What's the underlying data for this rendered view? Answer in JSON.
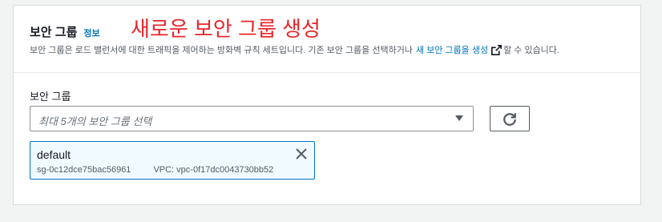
{
  "annotation": "새로운 보안 그룹 생성",
  "header": {
    "title": "보안 그룹",
    "info_link": "정보",
    "description_prefix": "보안 그룹은 로드 밸런서에 대한 트래픽을 제어하는 방화벽 규칙 세트입니다. 기존 보안 그룹을 선택하거나",
    "description_link": "새 보안 그룹을 생성",
    "description_suffix": "할 수 있습니다."
  },
  "field": {
    "label": "보안 그룹",
    "placeholder": "최대 5개의 보안 그룹 선택"
  },
  "selected": [
    {
      "name": "default",
      "id": "sg-0c12dce75bac56961",
      "vpc": "VPC: vpc-0f17dc0043730bb52"
    }
  ],
  "icons": {
    "info": "external-link-icon",
    "refresh": "refresh-icon",
    "dropdown": "caret-down-icon",
    "remove": "close-icon"
  },
  "colors": {
    "link": "#0073bb",
    "annotation": "#e8262a",
    "token_border": "#0073bb",
    "token_bg": "#f1faff"
  }
}
